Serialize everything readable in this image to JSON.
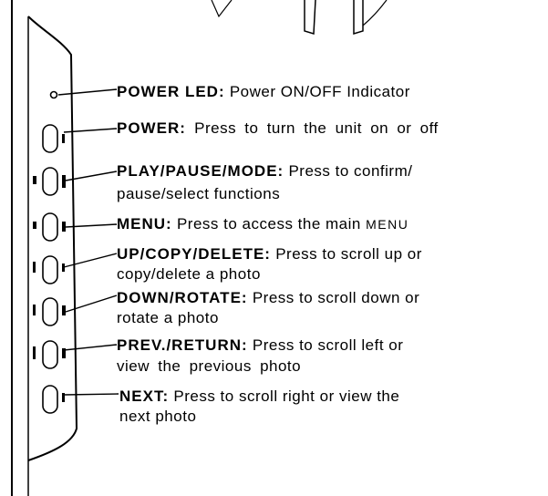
{
  "buttons": [
    {
      "id": "power-led",
      "title": "POWER LED:",
      "line1": "Power ON/OFF Indicator",
      "line2": ""
    },
    {
      "id": "power",
      "title": "POWER:",
      "line1": "Press to turn the unit on or off",
      "line2": ""
    },
    {
      "id": "play-pause-mode",
      "title": "PLAY/PAUSE/MODE:",
      "line1": "Press to confirm/",
      "line2": "pause/select functions"
    },
    {
      "id": "menu",
      "title": "MENU:",
      "line1": "Press to access the main",
      "line1_small": "MENU",
      "line2": ""
    },
    {
      "id": "up-copy-delete",
      "title": "UP/COPY/DELETE:",
      "line1": "Press to scroll up or",
      "line2": "copy/delete a photo"
    },
    {
      "id": "down-rotate",
      "title": "DOWN/ROTATE:",
      "line1": "Press to scroll down or",
      "line2": "rotate a photo"
    },
    {
      "id": "prev-return",
      "title": "PREV./RETURN:",
      "line1": "Press to scroll left or",
      "line2": "view the previous photo"
    },
    {
      "id": "next",
      "title": "NEXT:",
      "line1": "Press to scroll right or view the",
      "line2": "next photo"
    }
  ],
  "colors": {
    "ink": "#000000",
    "paper": "#ffffff"
  }
}
